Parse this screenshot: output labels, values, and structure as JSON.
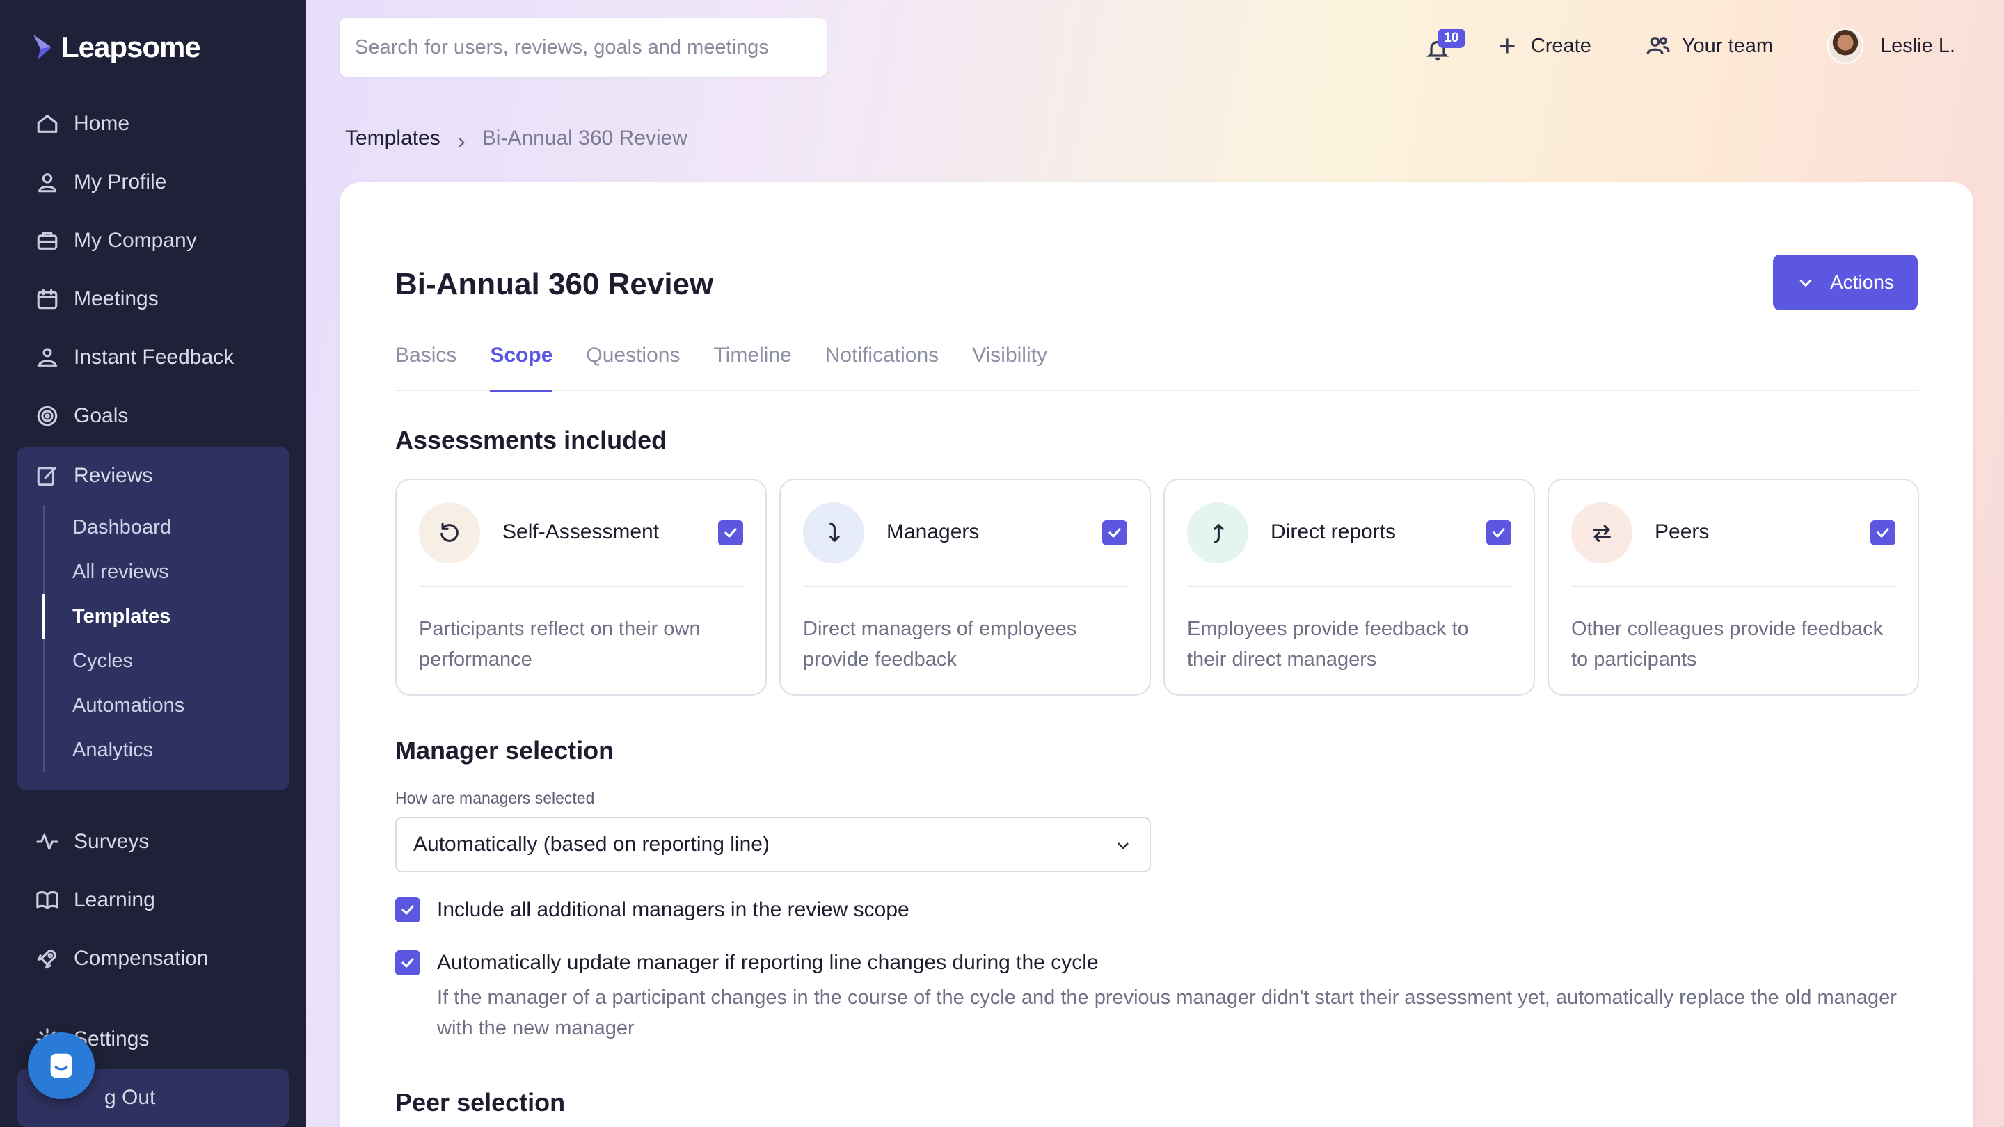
{
  "app": {
    "name": "Leapsome"
  },
  "sidebar": {
    "items": [
      {
        "label": "Home",
        "icon": "home-icon"
      },
      {
        "label": "My Profile",
        "icon": "user-icon"
      },
      {
        "label": "My Company",
        "icon": "briefcase-icon"
      },
      {
        "label": "Meetings",
        "icon": "calendar-icon"
      },
      {
        "label": "Instant Feedback",
        "icon": "feedback-icon"
      },
      {
        "label": "Goals",
        "icon": "target-icon"
      },
      {
        "label": "Reviews",
        "icon": "edit-icon"
      },
      {
        "label": "Surveys",
        "icon": "pulse-icon"
      },
      {
        "label": "Learning",
        "icon": "book-icon"
      },
      {
        "label": "Compensation",
        "icon": "rocket-icon"
      },
      {
        "label": "Settings",
        "icon": "gear-icon"
      },
      {
        "label": "Log Out",
        "icon": "logout-icon"
      }
    ],
    "reviews_sub": [
      "Dashboard",
      "All reviews",
      "Templates",
      "Cycles",
      "Automations",
      "Analytics"
    ],
    "active_sub": "Templates",
    "logout_visible": "g Out"
  },
  "topbar": {
    "search_placeholder": "Search for users, reviews, goals and meetings",
    "notification_count": "10",
    "create_label": "Create",
    "team_label": "Your team",
    "user_name": "Leslie L."
  },
  "breadcrumb": {
    "parent": "Templates",
    "current": "Bi-Annual 360 Review"
  },
  "page": {
    "title": "Bi-Annual 360 Review",
    "actions_label": "Actions",
    "tabs": [
      "Basics",
      "Scope",
      "Questions",
      "Timeline",
      "Notifications",
      "Visibility"
    ],
    "active_tab": "Scope"
  },
  "assessments": {
    "title": "Assessments included",
    "items": [
      {
        "name": "Self-Assessment",
        "desc": "Participants reflect on their own performance",
        "icon": "rotate-ccw-icon",
        "checked": true,
        "color": "#f7eee6"
      },
      {
        "name": "Managers",
        "desc": "Direct managers of employees provide feedback",
        "icon": "arrow-down-curve-icon",
        "checked": true,
        "color": "#e6ecfa"
      },
      {
        "name": "Direct reports",
        "desc": "Employees provide feedback to their direct managers",
        "icon": "arrow-up-curve-icon",
        "checked": true,
        "color": "#e4f4ef"
      },
      {
        "name": "Peers",
        "desc": "Other colleagues provide feedback to participants",
        "icon": "swap-icon",
        "checked": true,
        "color": "#fbe9e4"
      }
    ]
  },
  "manager_selection": {
    "title": "Manager selection",
    "field_label": "How are managers selected",
    "selected": "Automatically (based on reporting line)",
    "check1": "Include all additional managers in the review scope",
    "check2": "Automatically update manager if reporting line changes during the cycle",
    "help": "If the manager of a participant changes in the course of the cycle and the previous manager didn't start their assessment yet, automatically replace the old manager with the new manager"
  },
  "peer_selection": {
    "title": "Peer selection"
  },
  "colors": {
    "accent": "#5b57e0",
    "sidebar": "#1f2138",
    "sidebar_active": "#2e3260"
  }
}
